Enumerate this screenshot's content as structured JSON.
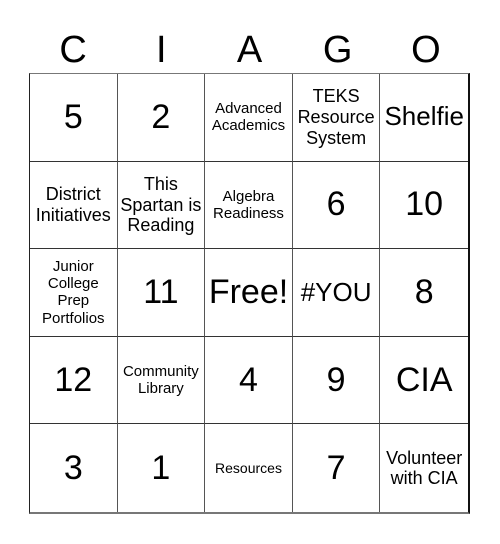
{
  "header": {
    "letters": [
      "C",
      "I",
      "A",
      "G",
      "O"
    ]
  },
  "board": {
    "rows": [
      [
        "5",
        "2",
        "Advanced Academics",
        "TEKS Resource System",
        "Shelfie"
      ],
      [
        "District Initiatives",
        "This Spartan is Reading",
        "Algebra Readiness",
        "6",
        "10"
      ],
      [
        "Junior College Prep Portfolios",
        "11",
        "Free!",
        "#YOU",
        "8"
      ],
      [
        "12",
        "Community Library",
        "4",
        "9",
        "CIA"
      ],
      [
        "3",
        "1",
        "Resources",
        "7",
        "Volunteer with CIA"
      ]
    ],
    "free_space": "Free!"
  }
}
